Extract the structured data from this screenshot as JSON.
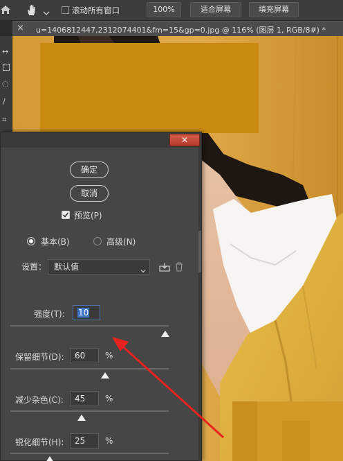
{
  "options_bar": {
    "scroll_all_label": "滚动所有窗口",
    "zoom_label": "100%",
    "fit_screen_label": "适合屏幕",
    "fill_screen_label": "填充屏幕"
  },
  "document_tab": {
    "close_glyph": "×",
    "title": "u=1406812447,2312074401&fm=15&gp=0.jpg @ 116% (图层 1, RGB/8#) *"
  },
  "dialog": {
    "close_glyph": "✕",
    "ok_label": "确定",
    "cancel_label": "取消",
    "preview_label": "预览(P)",
    "preview_checked": true,
    "mode_basic_label": "基本(B)",
    "mode_advanced_label": "高级(N)",
    "mode_selected": "basic",
    "settings_label": "设置：",
    "settings_value": "默认值",
    "strength_label": "强度(T):",
    "strength_value": "10",
    "preserve_label": "保留细节(D):",
    "preserve_value": "60",
    "preserve_unit": "%",
    "noise_label": "减少杂色(C):",
    "noise_value": "45",
    "noise_unit": "%",
    "sharpen_label": "锐化细节(H):",
    "sharpen_value": "25",
    "sharpen_unit": "%"
  },
  "sliders": {
    "strength_fraction": 0.98,
    "preserve_fraction": 0.6,
    "noise_fraction": 0.45,
    "sharpen_fraction": 0.25
  },
  "colors": {
    "annotation_arrow": "#e8231f",
    "censor_block": "#c98a10",
    "close_button": "#c24a38"
  },
  "icons": [
    "home-icon",
    "hand-icon",
    "chevron-down-icon",
    "save-preset-icon",
    "trash-icon",
    "cursor-icon"
  ]
}
